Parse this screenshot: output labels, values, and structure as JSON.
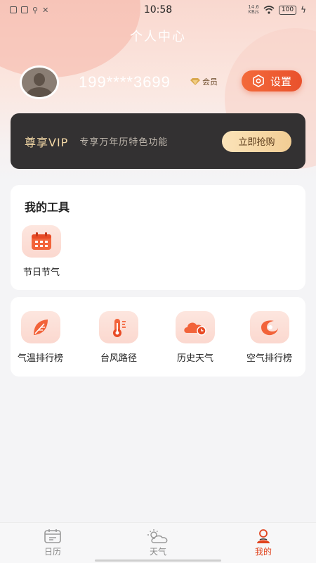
{
  "status_bar": {
    "time": "10:58",
    "network": "14.6\nKB/s",
    "battery": "100"
  },
  "header": {
    "title": "个人中心"
  },
  "profile": {
    "phone": "199****3699",
    "member_label": "会员",
    "settings_label": "设置"
  },
  "vip": {
    "title": "尊享VIP",
    "description": "专享万年历特色功能",
    "button_label": "立即抢购"
  },
  "tools": {
    "title": "我的工具",
    "items": [
      {
        "label": "节日节气",
        "icon": "calendar-icon"
      }
    ]
  },
  "services": {
    "items": [
      {
        "label": "气温排行榜",
        "icon": "leaf-icon"
      },
      {
        "label": "台风路径",
        "icon": "thermometer-icon"
      },
      {
        "label": "历史天气",
        "icon": "cloud-clock-icon"
      },
      {
        "label": "空气排行榜",
        "icon": "typhoon-icon"
      }
    ]
  },
  "nav": {
    "items": [
      {
        "label": "日历",
        "icon": "calendar-nav-icon",
        "active": false
      },
      {
        "label": "天气",
        "icon": "weather-nav-icon",
        "active": false
      },
      {
        "label": "我的",
        "icon": "profile-nav-icon",
        "active": true
      }
    ]
  },
  "colors": {
    "accent": "#e9512c",
    "vip_gold": "#f3d8a6",
    "vip_bg": "#333132"
  }
}
